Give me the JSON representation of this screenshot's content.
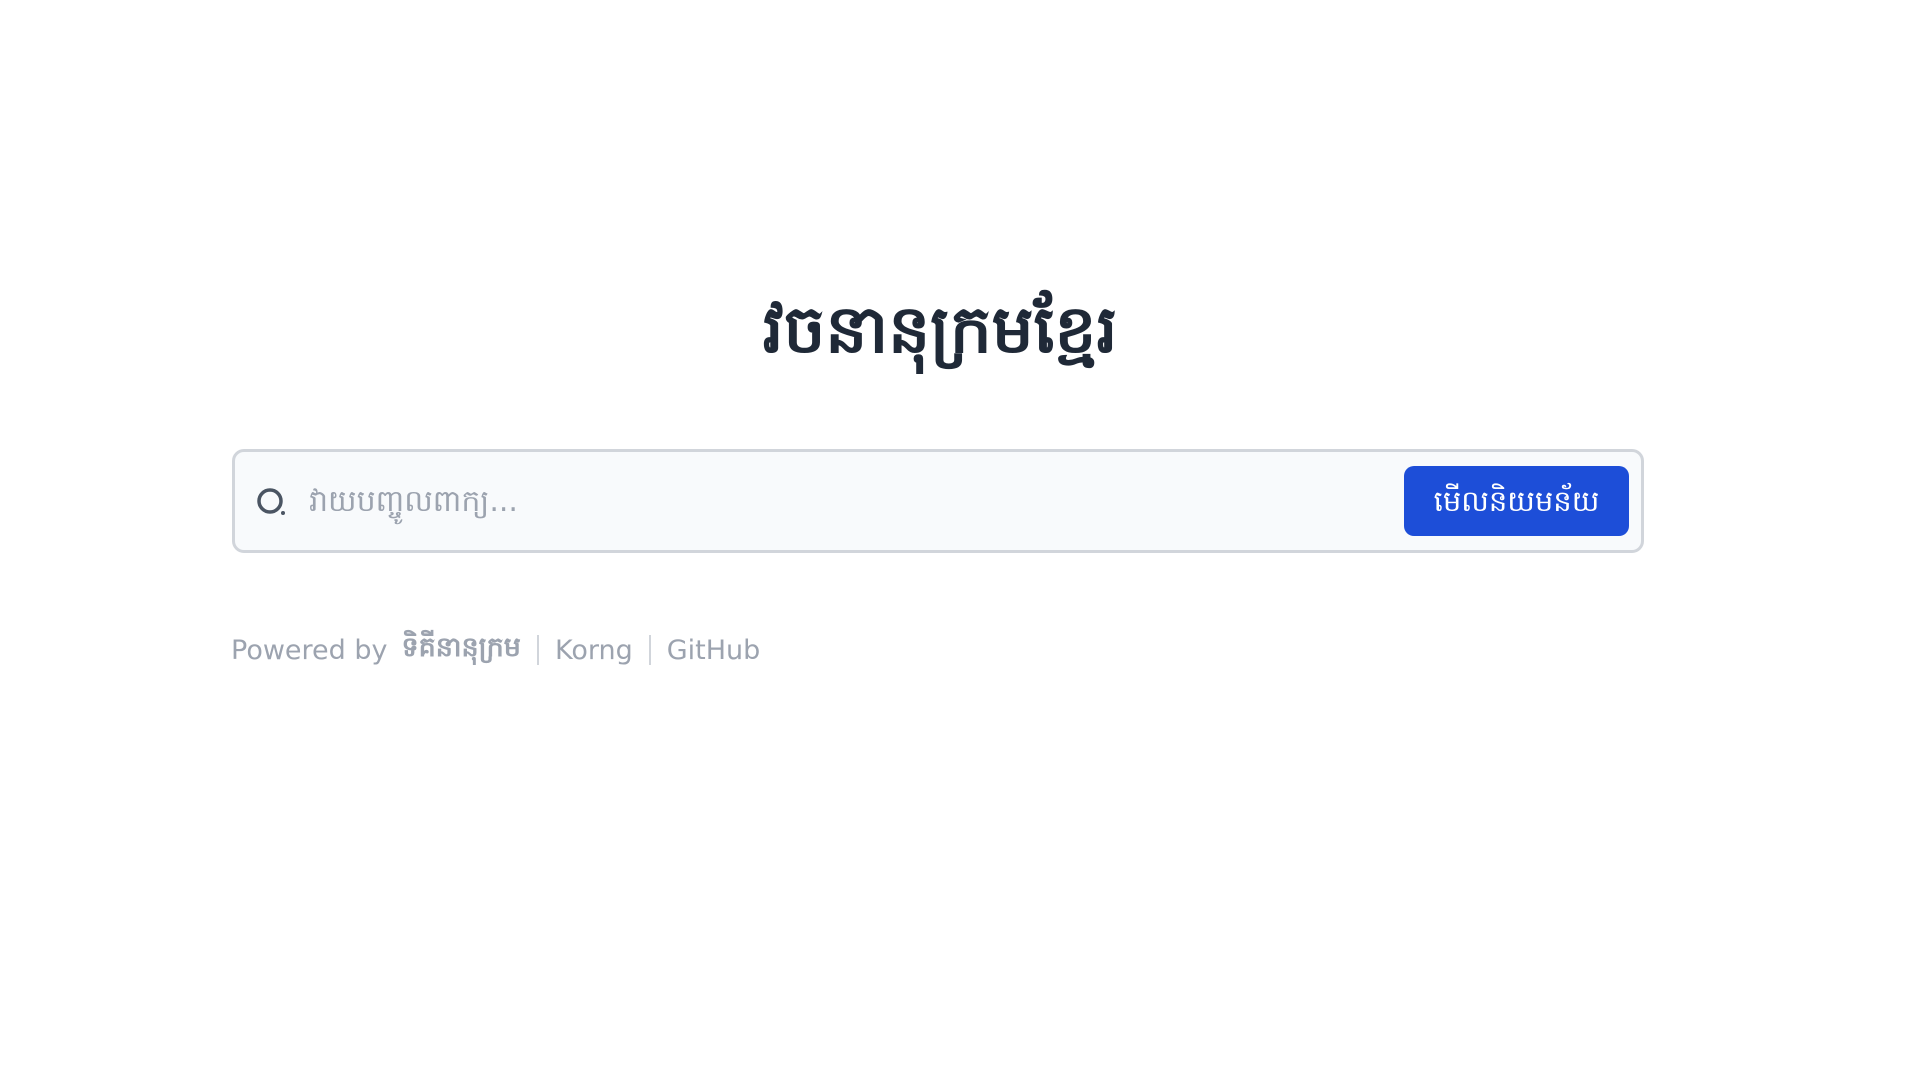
{
  "header": {
    "title": "វចនានុក្រមខ្មែរ"
  },
  "search": {
    "placeholder": "វាយបញ្ចូលពាក្យ...",
    "value": "",
    "submit_label": "មើលនិយមន័យ",
    "icon": "search-icon"
  },
  "footer": {
    "powered_by_prefix": "Powered by",
    "brand": "ទិគីនានុក្រម",
    "links": [
      {
        "label": "Korng"
      },
      {
        "label": "GitHub"
      }
    ]
  },
  "colors": {
    "accent": "#1d4ed8",
    "title": "#1f2937",
    "muted": "#9ca3af",
    "border": "#d1d5db",
    "input_bg": "#f8fafc"
  }
}
